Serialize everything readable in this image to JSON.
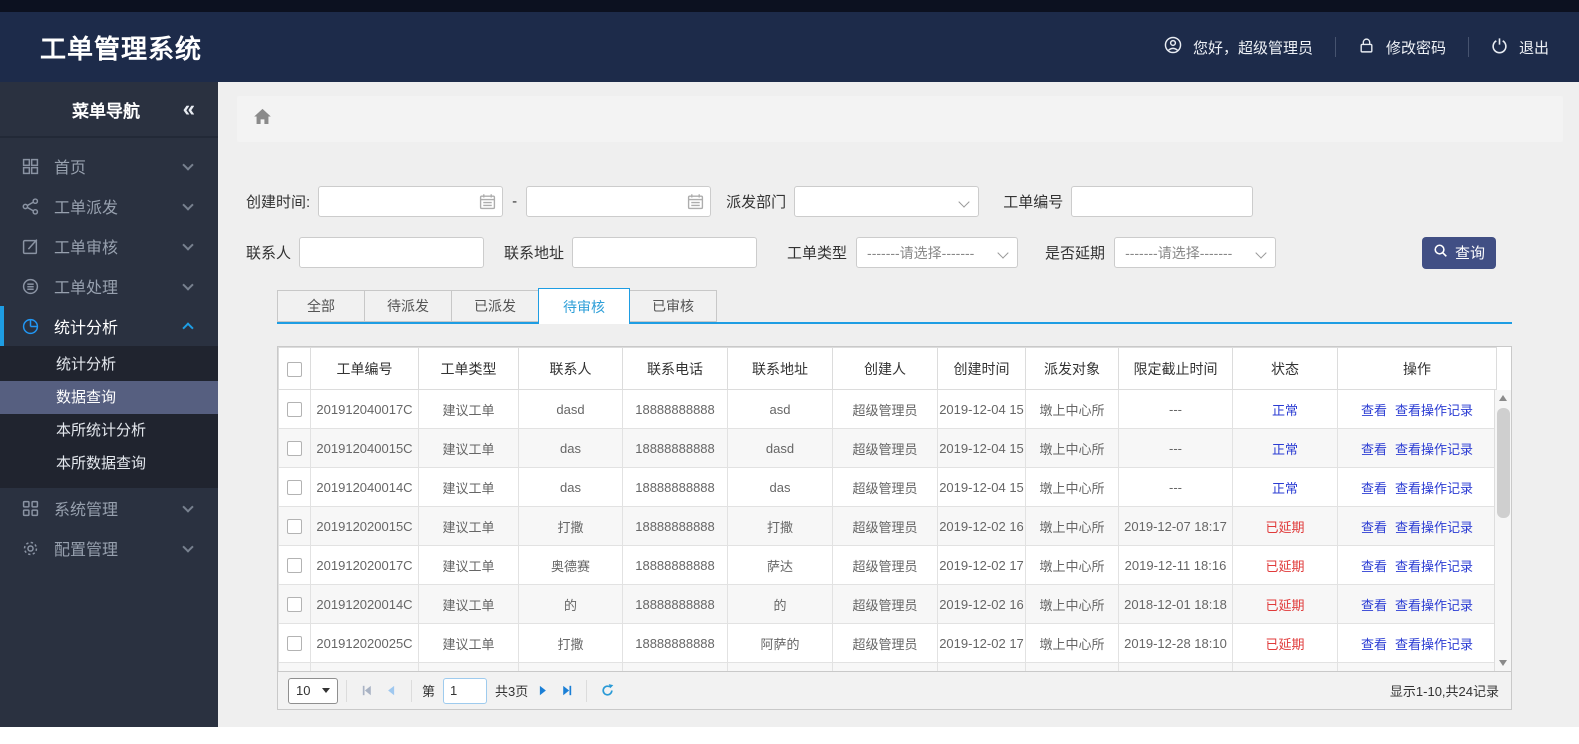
{
  "header": {
    "title": "工单管理系统",
    "greeting": "您好，超级管理员",
    "change_password": "修改密码",
    "logout": "退出"
  },
  "sidebar": {
    "title": "菜单导航",
    "collapse_glyph": "«",
    "items": [
      {
        "label": "首页",
        "icon": "grid-icon"
      },
      {
        "label": "工单派发",
        "icon": "share-icon"
      },
      {
        "label": "工单审核",
        "icon": "edit-icon"
      },
      {
        "label": "工单处理",
        "icon": "process-icon"
      },
      {
        "label": "统计分析",
        "icon": "pie-chart-icon",
        "expanded": true,
        "children": [
          {
            "label": "统计分析",
            "active": false
          },
          {
            "label": "数据查询",
            "active": true
          },
          {
            "label": "本所统计分析",
            "active": false
          },
          {
            "label": "本所数据查询",
            "active": false
          }
        ]
      },
      {
        "label": "系统管理",
        "icon": "modules-icon"
      },
      {
        "label": "配置管理",
        "icon": "gear-icon"
      }
    ]
  },
  "filters": {
    "created_time_label": "创建时间:",
    "range_dash": "-",
    "dispatch_dept_label": "派发部门",
    "order_no_label": "工单编号",
    "contact_label": "联系人",
    "address_label": "联系地址",
    "order_type_label": "工单类型",
    "delayed_label": "是否延期",
    "select_placeholder": "-------请选择-------",
    "search_button": "查询"
  },
  "tabs": {
    "items": [
      {
        "label": "全部",
        "active": false
      },
      {
        "label": "待派发",
        "active": false
      },
      {
        "label": "已派发",
        "active": false
      },
      {
        "label": "待审核",
        "active": true
      },
      {
        "label": "已审核",
        "active": false
      }
    ]
  },
  "table": {
    "columns": [
      "工单编号",
      "工单类型",
      "联系人",
      "联系电话",
      "联系地址",
      "创建人",
      "创建时间",
      "派发对象",
      "限定截止时间",
      "状态",
      "操作"
    ],
    "action_view": "查看",
    "action_log": "查看操作记录",
    "rows": [
      {
        "order_no": "201912040017C",
        "type": "建议工单",
        "contact": "dasd",
        "phone": "18888888888",
        "address": "asd",
        "creator": "超级管理员",
        "created": "2019-12-04 15",
        "target": "墩上中心所",
        "deadline": "---",
        "status": "正常",
        "delayed": false
      },
      {
        "order_no": "201912040015C",
        "type": "建议工单",
        "contact": "das",
        "phone": "18888888888",
        "address": "dasd",
        "creator": "超级管理员",
        "created": "2019-12-04 15",
        "target": "墩上中心所",
        "deadline": "---",
        "status": "正常",
        "delayed": false
      },
      {
        "order_no": "201912040014C",
        "type": "建议工单",
        "contact": "das",
        "phone": "18888888888",
        "address": "das",
        "creator": "超级管理员",
        "created": "2019-12-04 15",
        "target": "墩上中心所",
        "deadline": "---",
        "status": "正常",
        "delayed": false
      },
      {
        "order_no": "201912020015C",
        "type": "建议工单",
        "contact": "打撒",
        "phone": "18888888888",
        "address": "打撒",
        "creator": "超级管理员",
        "created": "2019-12-02 16",
        "target": "墩上中心所",
        "deadline": "2019-12-07 18:17",
        "status": "已延期",
        "delayed": true
      },
      {
        "order_no": "201912020017C",
        "type": "建议工单",
        "contact": "奥德赛",
        "phone": "18888888888",
        "address": "萨达",
        "creator": "超级管理员",
        "created": "2019-12-02 17",
        "target": "墩上中心所",
        "deadline": "2019-12-11 18:16",
        "status": "已延期",
        "delayed": true
      },
      {
        "order_no": "201912020014C",
        "type": "建议工单",
        "contact": "的",
        "phone": "18888888888",
        "address": "的",
        "creator": "超级管理员",
        "created": "2019-12-02 16",
        "target": "墩上中心所",
        "deadline": "2018-12-01 18:18",
        "status": "已延期",
        "delayed": true
      },
      {
        "order_no": "201912020025C",
        "type": "建议工单",
        "contact": "打撒",
        "phone": "18888888888",
        "address": "阿萨的",
        "creator": "超级管理员",
        "created": "2019-12-02 17",
        "target": "墩上中心所",
        "deadline": "2019-12-28 18:10",
        "status": "已延期",
        "delayed": true
      }
    ]
  },
  "pagination": {
    "page_size": "10",
    "page_prefix": "第",
    "page_value": "1",
    "total_pages": "共3页",
    "summary": "显示1-10,共24记录"
  },
  "colors": {
    "accent_blue": "#1e9de3",
    "link_blue": "#2b3cd3",
    "status_normal": "#2b3cd3",
    "status_delayed": "#e03a3a",
    "button_bg": "#414f84",
    "header_bg": "#1d2b4a",
    "top_strip_bg": "#0c1120",
    "sidebar_bg": "#2a3140",
    "submenu_bg": "#20242f",
    "submenu_selected_bg": "#565f80"
  }
}
